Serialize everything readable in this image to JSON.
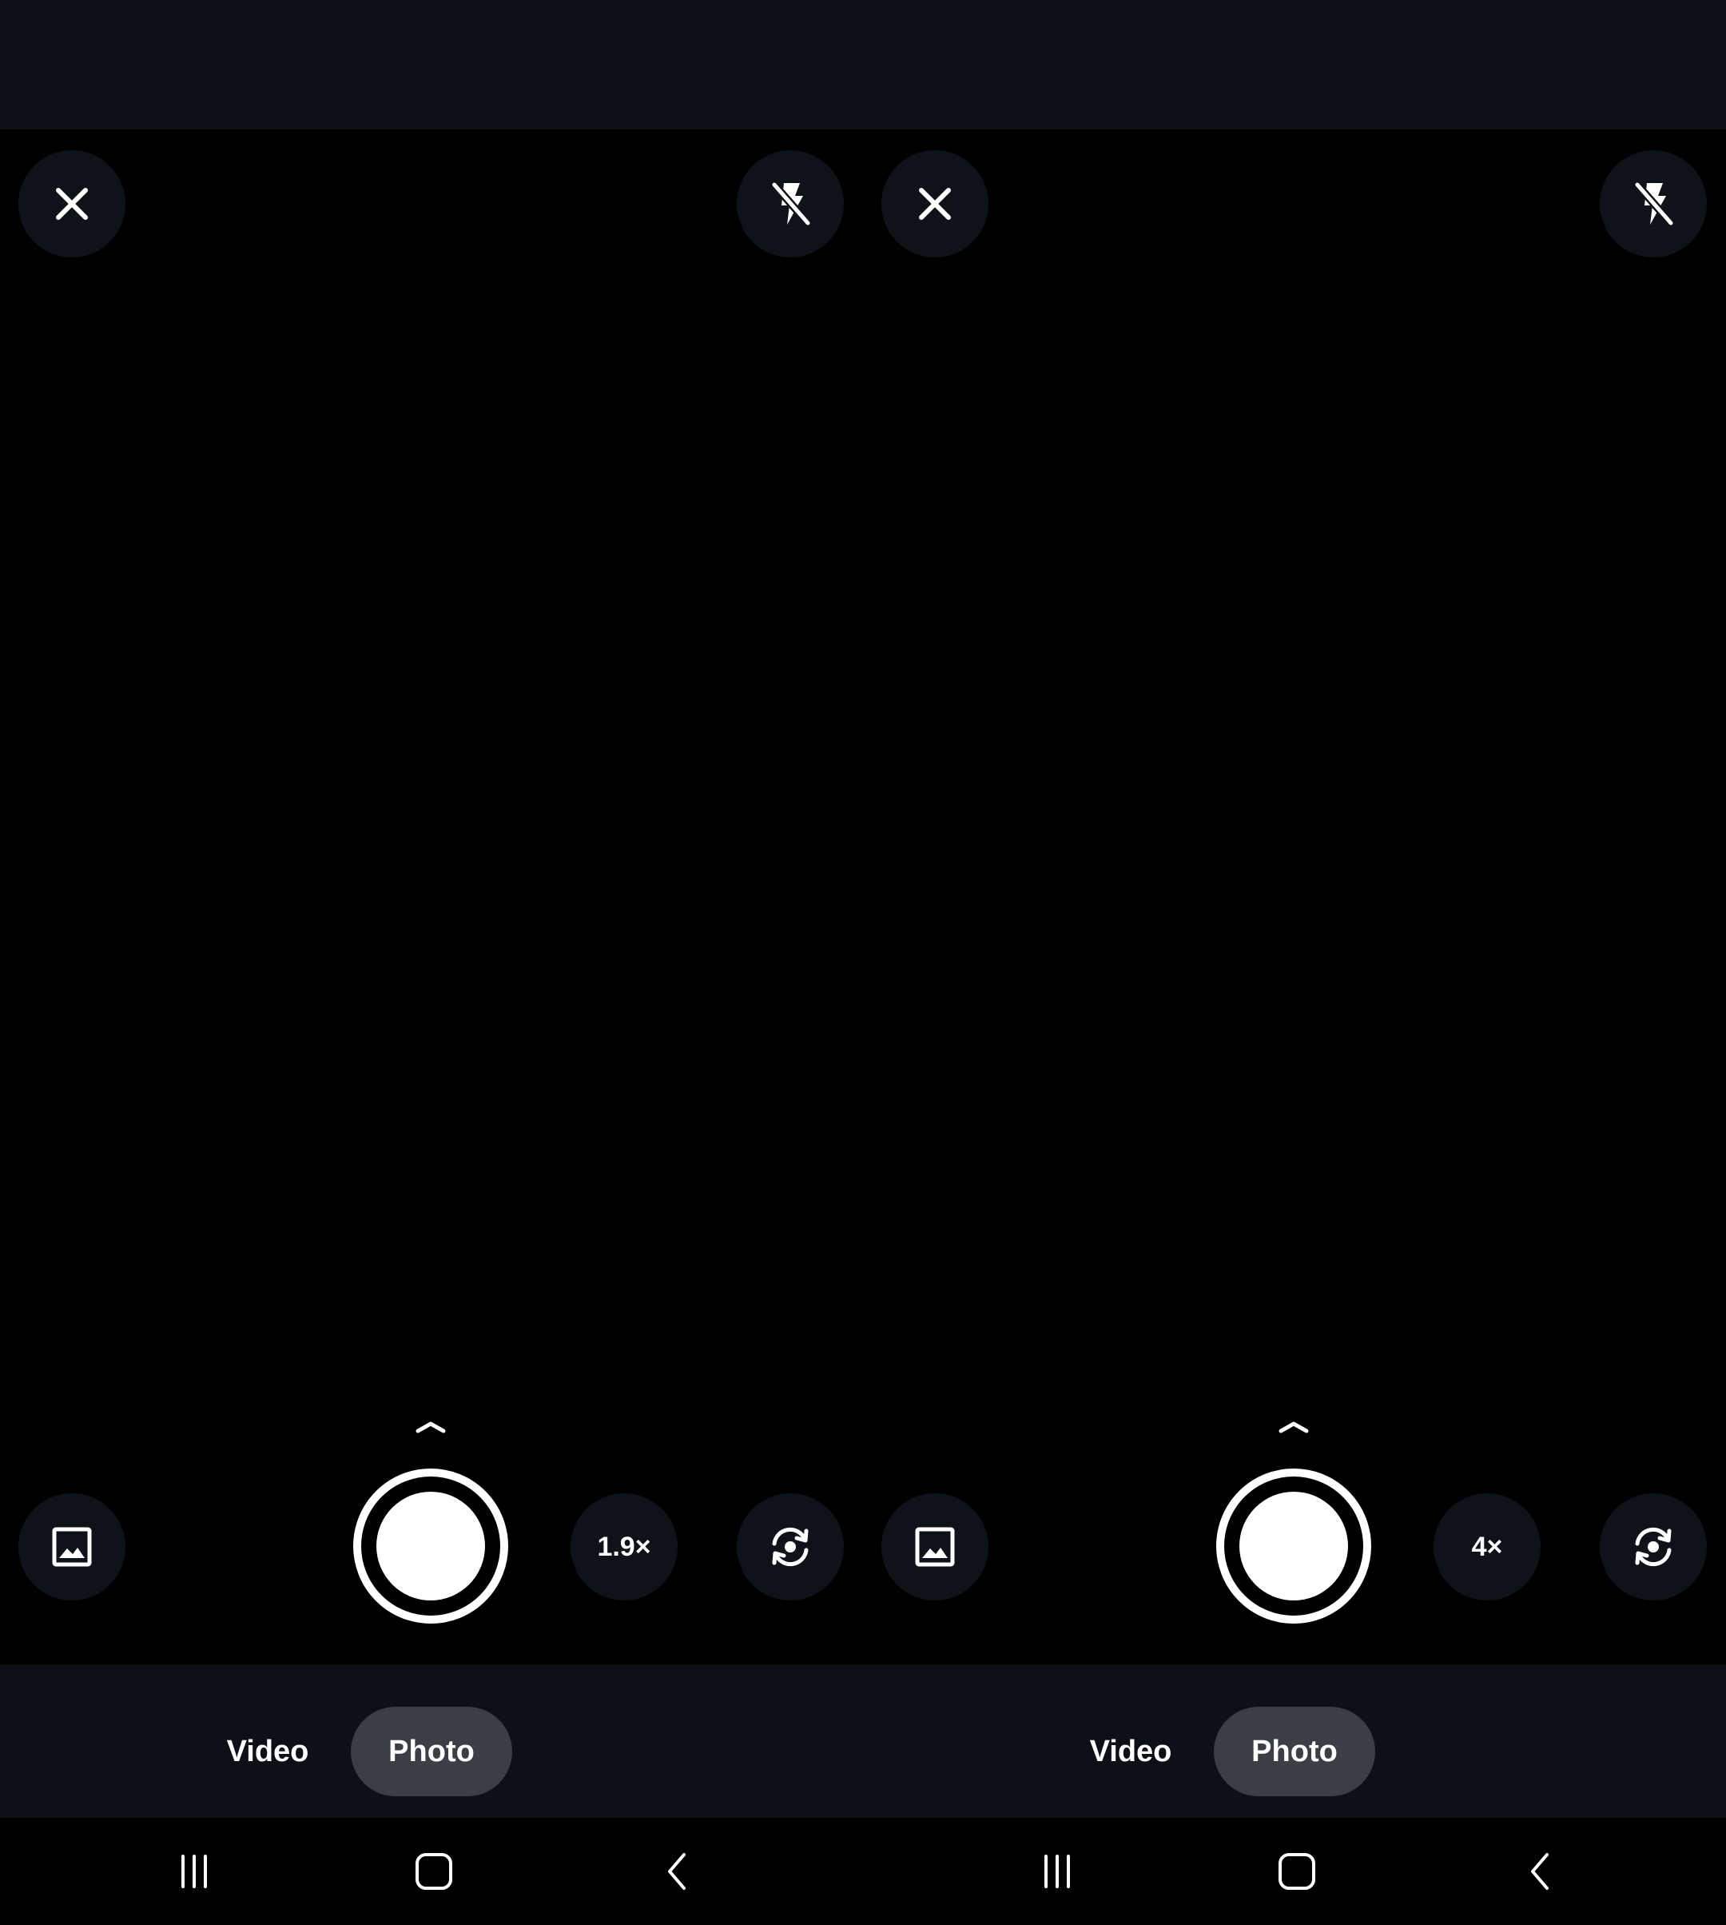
{
  "colors": {
    "status_bar": "#0b1117",
    "viewfinder": "#000000",
    "button_bg": "#0d1318",
    "mode_bar": "#0b1117",
    "mode_selected_bg": "#3a3f45",
    "icon": "#ffffff"
  },
  "left_pane": {
    "top_controls": {
      "close_icon": "close-icon",
      "flash_icon": "flash-off-icon"
    },
    "bottom_controls": {
      "gallery_icon": "gallery-icon",
      "zoom_label": "1.9×",
      "flip_icon": "flip-camera-icon"
    },
    "modes": {
      "video": "Video",
      "photo": "Photo",
      "selected": "Photo"
    }
  },
  "right_pane": {
    "top_controls": {
      "close_icon": "close-icon",
      "flash_icon": "flash-off-icon"
    },
    "bottom_controls": {
      "gallery_icon": "gallery-icon",
      "zoom_label": "4×",
      "flip_icon": "flip-camera-icon"
    },
    "modes": {
      "video": "Video",
      "photo": "Photo",
      "selected": "Photo"
    }
  },
  "nav_bar": {
    "recents_icon": "recents-icon",
    "home_icon": "home-icon",
    "back_icon": "back-icon"
  }
}
